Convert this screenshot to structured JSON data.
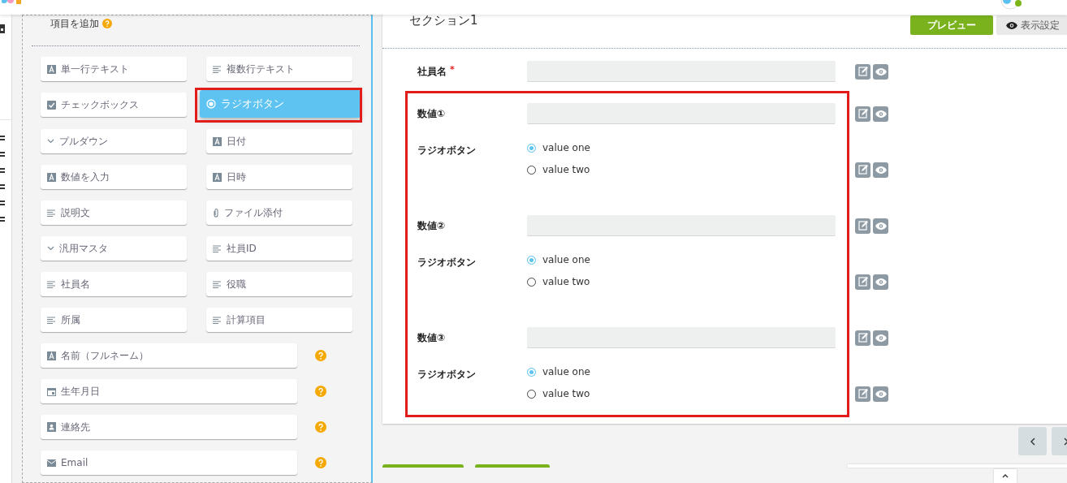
{
  "palette": {
    "title": "項目を追加",
    "items": [
      {
        "label": "単一行テキスト",
        "kind": "text",
        "selected": false
      },
      {
        "label": "複数行テキスト",
        "kind": "lines",
        "selected": false
      },
      {
        "label": "チェックボックス",
        "kind": "check",
        "selected": false
      },
      {
        "label": "ラジオボタン",
        "kind": "radio",
        "selected": true
      },
      {
        "label": "プルダウン",
        "kind": "dropdown",
        "selected": false
      },
      {
        "label": "日付",
        "kind": "text",
        "selected": false
      },
      {
        "label": "数値を入力",
        "kind": "text",
        "selected": false
      },
      {
        "label": "日時",
        "kind": "text",
        "selected": false
      },
      {
        "label": "説明文",
        "kind": "lines",
        "selected": false
      },
      {
        "label": "ファイル添付",
        "kind": "clip",
        "selected": false
      },
      {
        "label": "汎用マスタ",
        "kind": "dropdown",
        "selected": false
      },
      {
        "label": "社員ID",
        "kind": "lines",
        "selected": false
      },
      {
        "label": "社員名",
        "kind": "lines",
        "selected": false
      },
      {
        "label": "役職",
        "kind": "lines",
        "selected": false
      },
      {
        "label": "所属",
        "kind": "lines",
        "selected": false
      },
      {
        "label": "計算項目",
        "kind": "lines",
        "selected": false
      }
    ],
    "wide_items": [
      {
        "label": "名前（フルネーム）",
        "kind": "text"
      },
      {
        "label": "生年月日",
        "kind": "calendar"
      },
      {
        "label": "連絡先",
        "kind": "contact"
      },
      {
        "label": "Email",
        "kind": "mail"
      }
    ]
  },
  "form": {
    "section_title": "セクション1",
    "buttons": [
      {
        "label": "プレビュー",
        "kind": "primary"
      },
      {
        "label": "表示設定",
        "kind": "settings"
      }
    ],
    "groups": [
      {
        "highlighted": false,
        "fields": [
          {
            "kind": "input",
            "label": "社員名",
            "required_mark": "*"
          }
        ]
      },
      {
        "highlighted": true,
        "fields": [
          {
            "kind": "input",
            "label": "数値①"
          },
          {
            "kind": "radio",
            "label": "ラジオボタン",
            "options": [
              {
                "label": "value one",
                "selected": true
              },
              {
                "label": "value two",
                "selected": false
              }
            ]
          },
          {
            "kind": "input",
            "label": "数値②"
          },
          {
            "kind": "radio",
            "label": "ラジオボタン",
            "options": [
              {
                "label": "value one",
                "selected": true
              },
              {
                "label": "value two",
                "selected": false
              }
            ]
          },
          {
            "kind": "input",
            "label": "数値③"
          },
          {
            "kind": "radio",
            "label": "ラジオボタン",
            "options": [
              {
                "label": "value one",
                "selected": true
              },
              {
                "label": "value two",
                "selected": false
              }
            ]
          }
        ]
      }
    ]
  }
}
